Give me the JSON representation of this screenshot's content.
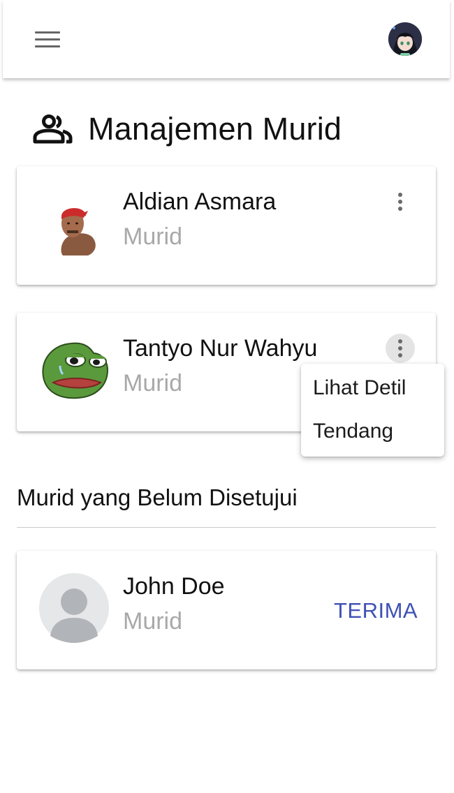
{
  "appbar": {
    "menu_icon": "hamburger-menu-icon",
    "profile_icon": "profile-avatar"
  },
  "page": {
    "title": "Manajemen Murid",
    "title_icon": "people-icon"
  },
  "students": [
    {
      "name": "Aldian Asmara",
      "role": "Murid",
      "avatar": "student-photo",
      "more_icon": "more-vertical-icon"
    },
    {
      "name": "Tantyo Nur Wahyu",
      "role": "Murid",
      "avatar": "frog-avatar",
      "more_icon": "more-vertical-icon"
    }
  ],
  "context_menu": {
    "items": [
      "Lihat Detil",
      "Tendang"
    ]
  },
  "pending": {
    "title": "Murid yang Belum Disetujui",
    "items": [
      {
        "name": "John Doe",
        "role": "Murid",
        "avatar": "default-person-avatar",
        "action": "TERIMA"
      }
    ]
  },
  "colors": {
    "accent": "#3f51b5",
    "secondary_text": "#a8a8a8",
    "appbar_bg": "#ffffff"
  }
}
